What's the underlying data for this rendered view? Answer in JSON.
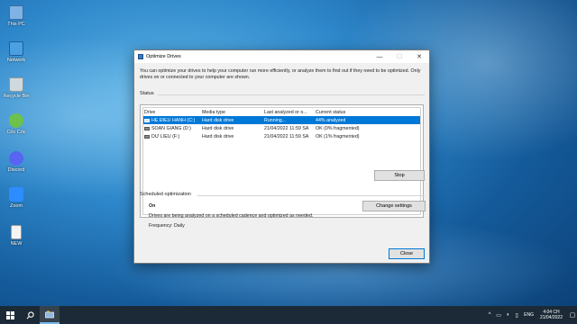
{
  "desktop": {
    "icons": [
      {
        "label": "This PC",
        "icon": "computer-icon",
        "color": "#7fb3e6"
      },
      {
        "label": "Network",
        "icon": "network-icon",
        "color": "#4aa0e0"
      },
      {
        "label": "Recycle Bin",
        "icon": "recycle-bin-icon",
        "color": "#cfd8dc"
      },
      {
        "label": "Cốc Cốc",
        "icon": "coccoc-browser-icon",
        "color": "#6cc24a"
      },
      {
        "label": "Discord",
        "icon": "discord-icon",
        "color": "#5865f2"
      },
      {
        "label": "Zoom",
        "icon": "zoom-icon",
        "color": "#2d8cff"
      },
      {
        "label": "NEW",
        "icon": "text-file-icon",
        "color": "#f4f4f4"
      }
    ]
  },
  "dialog": {
    "title": "Optimize Drives",
    "controls": {
      "minimize": "—",
      "maximize": "☐",
      "close": "✕"
    },
    "description": "You can optimize your drives to help your computer run more efficiently, or analyze them to find out if they need to be optimized. Only drives on or connected to your computer are shown.",
    "status_label": "Status",
    "columns": [
      "Drive",
      "Media type",
      "Last analyzed or o...",
      "Current status"
    ],
    "drives": [
      {
        "drive": "HỆ ĐIỀU HÀNH (C:)",
        "media": "Hard disk drive",
        "last": "Running...",
        "status": "44% analyzed",
        "selected": true
      },
      {
        "drive": "SOẠN GIẢNG (D:)",
        "media": "Hard disk drive",
        "last": "21/04/2022 11:59 SA",
        "status": "OK (0% fragmented)",
        "selected": false
      },
      {
        "drive": "DỮ LIỆU (F:)",
        "media": "Hard disk drive",
        "last": "21/04/2022 11:59 SA",
        "status": "OK (1% fragmented)",
        "selected": false
      }
    ],
    "stop_label": "Stop",
    "scheduled_label": "Scheduled optimization",
    "schedule_state": "On",
    "schedule_desc": "Drives are being analyzed on a scheduled cadence and optimized as needed.",
    "frequency": "Frequency: Daily",
    "change_settings_label": "Change settings",
    "close_label": "Close"
  },
  "taskbar": {
    "start_icon": "windows-start-icon",
    "search_icon": "search-icon",
    "tray": {
      "chevron": "^",
      "language": "ENG",
      "time": "4:04 CH",
      "date": "21/04/2022"
    }
  }
}
